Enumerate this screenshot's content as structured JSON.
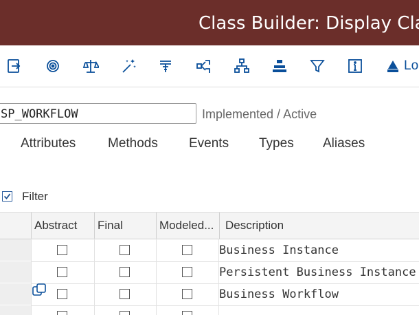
{
  "window": {
    "title": "Class Builder: Display Class"
  },
  "toolbar": {
    "icons": [
      "switch-mode-icon",
      "other-object-icon",
      "check-icon",
      "activate-icon",
      "where-used-icon",
      "object-navigation-icon",
      "hierarchy-icon",
      "display-object-list-icon",
      "filter-icon",
      "info-icon",
      "local-types-icon"
    ],
    "overflow_label": "Lo"
  },
  "class_field": {
    "value": "SP_WORKFLOW"
  },
  "status": {
    "text": "Implemented / Active"
  },
  "tabs": [
    {
      "label": "Attributes"
    },
    {
      "label": "Methods"
    },
    {
      "label": "Events"
    },
    {
      "label": "Types"
    },
    {
      "label": "Aliases"
    }
  ],
  "filter": {
    "label": "Filter",
    "checked": true
  },
  "table": {
    "columns": [
      "Abstract",
      "Final",
      "Modeled...",
      "Description"
    ],
    "rows": [
      {
        "abstract": false,
        "final": false,
        "modeled": false,
        "description": "Business Instance"
      },
      {
        "abstract": false,
        "final": false,
        "modeled": false,
        "description": "Persistent Business Instance"
      },
      {
        "abstract": false,
        "final": false,
        "modeled": false,
        "description": "Business Workflow"
      },
      {
        "abstract": false,
        "final": false,
        "modeled": false,
        "description": ""
      }
    ]
  }
}
